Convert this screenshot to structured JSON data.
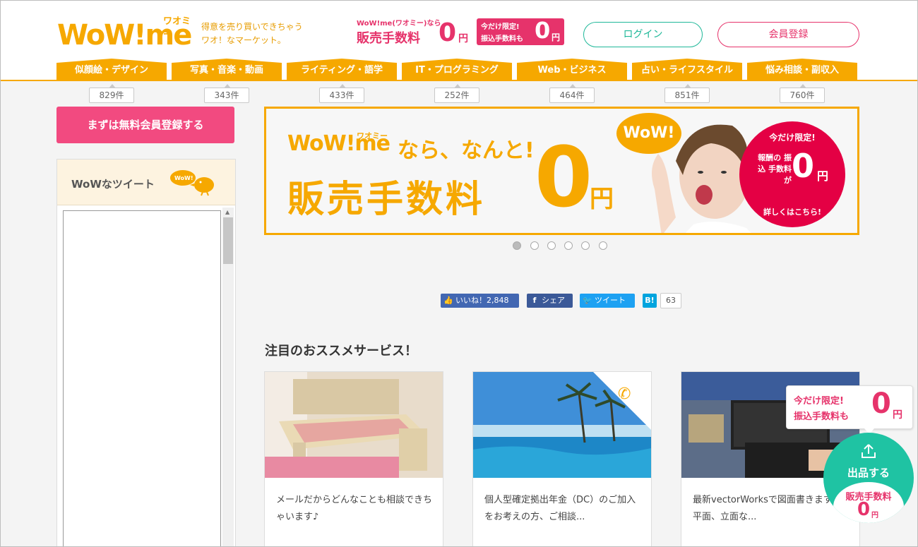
{
  "header": {
    "logo_text": "WoW!",
    "logo_me": "me",
    "logo_kana": "ワオミー",
    "tagline_1": "得意を売り買いできちゃう",
    "tagline_2": "ワオ！なマーケット。",
    "promo_small": "WoW!me(ワオミー)なら",
    "promo_big": "販売手数料",
    "promo_zero": "0",
    "promo_yen": "円",
    "promo_box_l1": "今だけ限定!",
    "promo_box_l2": "振込手数料も",
    "promo_box_zero": "0",
    "promo_box_yen": "円",
    "login_label": "ログイン",
    "register_label": "会員登録"
  },
  "nav": {
    "tabs": [
      {
        "label": "似顔絵・デザイン",
        "count": "829件"
      },
      {
        "label": "写真・音楽・動画",
        "count": "343件"
      },
      {
        "label": "ライティング・語学",
        "count": "433件"
      },
      {
        "label": "IT・プログラミング",
        "count": "252件"
      },
      {
        "label": "Web・ビジネス",
        "count": "464件"
      },
      {
        "label": "占い・ライフスタイル",
        "count": "851件"
      },
      {
        "label": "悩み相談・副収入",
        "count": "760件"
      }
    ]
  },
  "sidebar": {
    "cta_label": "まずは無料会員登録する",
    "tweet_title": "WoWなツイート",
    "bird_text": "WoW!"
  },
  "banner": {
    "logo": "WoW!me",
    "logo_kana": "ワオミー",
    "headline": "なら、なんと!",
    "fee": "販売手数料",
    "zero": "0",
    "yen": "円",
    "bubble": "WoW!",
    "seal_top": "今だけ限定!",
    "seal_lines": "報酬の 振込 手数料が",
    "seal_zero": "0",
    "seal_yen": "円",
    "seal_bottom": "詳しくはこちら!",
    "slide_count": 6,
    "active_slide": 0
  },
  "social": {
    "like_label": "いいね！2,848",
    "share_label": "シェア",
    "tweet_label": "ツイート",
    "hatena_label": "B!",
    "hatena_count": "63"
  },
  "section": {
    "title": "注目のおススメサービス！",
    "cards": [
      {
        "text": "メールだからどんなことも相談できちゃいます♪"
      },
      {
        "text": "個人型確定拠出年金（DC）のご加入をお考えの方、ご相談..."
      },
      {
        "text": "最新vectorWorksで図面書きます。平面、立面な..."
      }
    ]
  },
  "floating": {
    "promo_l1": "今だけ限定!",
    "promo_l2": "振込手数料も",
    "promo_zero": "0",
    "promo_yen": "円",
    "sell_label": "出品する",
    "fee_label": "販売手数料",
    "fee_zero": "0",
    "fee_yen": "円"
  },
  "colors": {
    "brand_orange": "#f6a800",
    "brand_pink": "#e6336b",
    "brand_green": "#1fc3a3"
  }
}
